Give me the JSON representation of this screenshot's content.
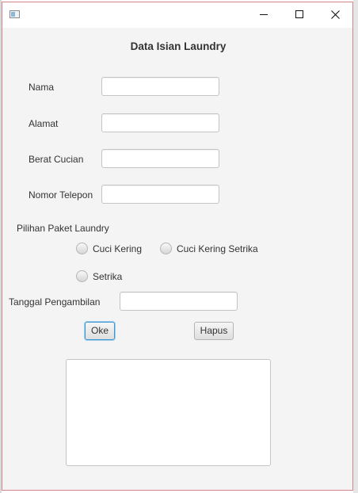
{
  "window": {
    "title_bar": {
      "icon": "java-app-icon",
      "minimize_icon": "minimize-icon",
      "maximize_icon": "maximize-icon",
      "close_icon": "close-icon"
    }
  },
  "form": {
    "title": "Data Isian Laundry",
    "fields": {
      "nama": {
        "label": "Nama",
        "value": ""
      },
      "alamat": {
        "label": "Alamat",
        "value": ""
      },
      "berat": {
        "label": "Berat Cucian",
        "value": ""
      },
      "telepon": {
        "label": "Nomor Telepon",
        "value": ""
      },
      "tanggal": {
        "label": "Tanggal Pengambilan",
        "value": ""
      }
    },
    "paket": {
      "label": "Pilihan Paket Laundry",
      "options": [
        "Cuci Kering",
        "Cuci Kering Setrika",
        "Setrika"
      ],
      "selected": null
    },
    "buttons": {
      "ok": "Oke",
      "hapus": "Hapus"
    },
    "output_text": ""
  }
}
